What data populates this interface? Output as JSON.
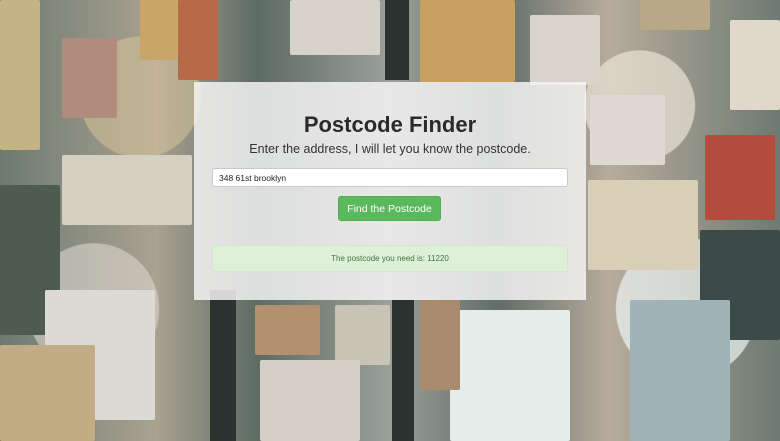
{
  "page": {
    "title": "Postcode Finder",
    "subtitle": "Enter the address, I will let you know the postcode."
  },
  "form": {
    "address_value": "348 61st brooklyn",
    "find_button_label": "Find the Postcode"
  },
  "result": {
    "message": "The postcode you need is: 11220"
  },
  "colors": {
    "button_green": "#5cb85c",
    "alert_background": "#dff0d8",
    "alert_text": "#3c763d"
  }
}
